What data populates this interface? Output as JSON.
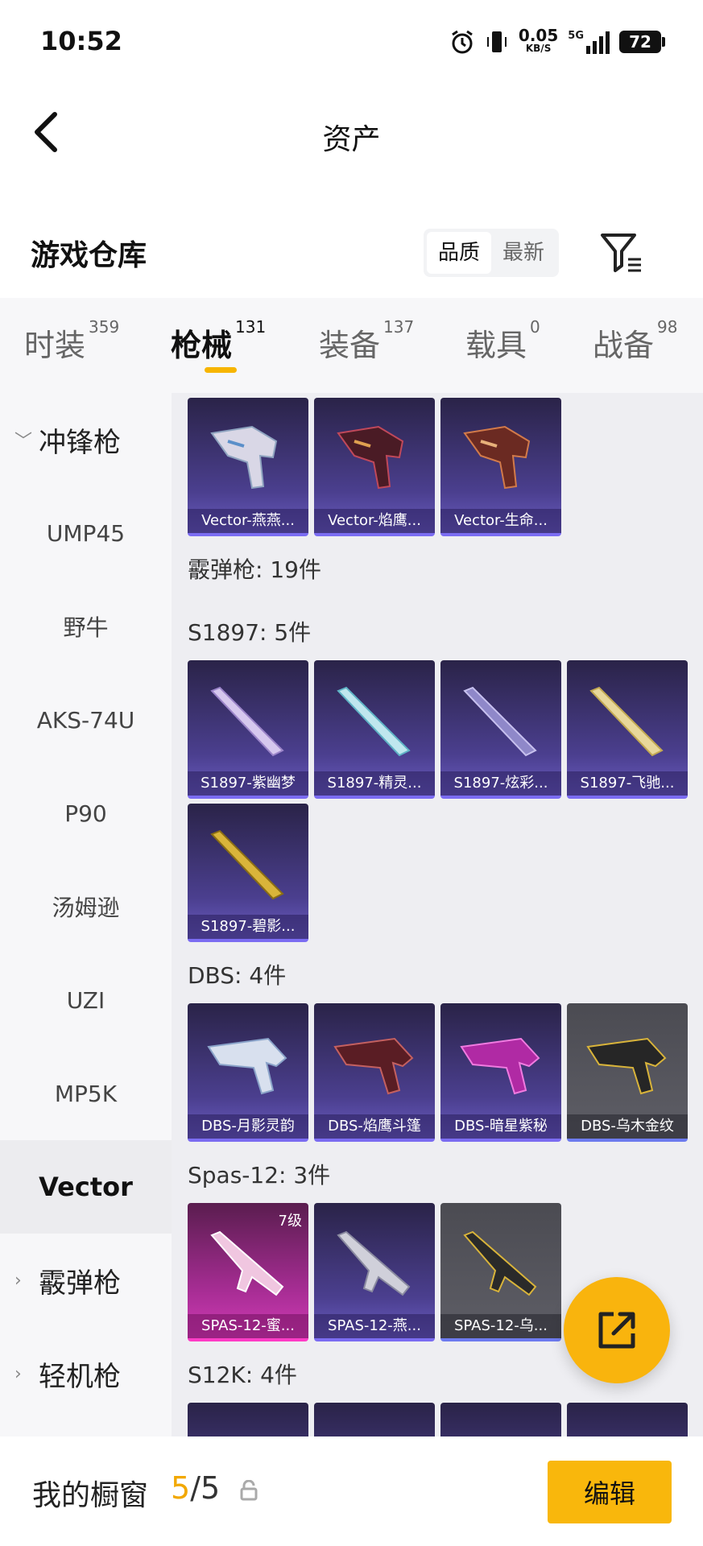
{
  "status": {
    "time": "10:52",
    "net_speed": "0.05",
    "net_unit": "KB/S",
    "signal": "5G",
    "battery": "72"
  },
  "header": {
    "title": "资产"
  },
  "warehouse": {
    "title": "游戏仓库",
    "sort_options": [
      "品质",
      "最新"
    ],
    "active_sort": "品质"
  },
  "tabs": [
    {
      "label": "时装",
      "count": "359"
    },
    {
      "label": "枪械",
      "count": "131"
    },
    {
      "label": "装备",
      "count": "137"
    },
    {
      "label": "载具",
      "count": "0"
    },
    {
      "label": "战备",
      "count": "98"
    }
  ],
  "active_tab": "枪械",
  "sidebar": {
    "group_smg": "冲锋枪",
    "items": [
      "UMP45",
      "野牛",
      "AKS-74U",
      "P90",
      "汤姆逊",
      "UZI",
      "MP5K",
      "Vector"
    ],
    "selected": "Vector",
    "group_shotgun": "霰弹枪",
    "group_lmg": "轻机枪"
  },
  "content": {
    "vector_cards": [
      "Vector-燕燕...",
      "Vector-焰鹰...",
      "Vector-生命..."
    ],
    "shotgun_header": "霰弹枪: 19件",
    "s1897_header": "S1897: 5件",
    "s1897_cards": [
      "S1897-紫幽梦",
      "S1897-精灵...",
      "S1897-炫彩...",
      "S1897-飞驰...",
      "S1897-碧影..."
    ],
    "dbs_header": "DBS: 4件",
    "dbs_cards": [
      "DBS-月影灵韵",
      "DBS-焰鹰斗篷",
      "DBS-暗星紫秘",
      "DBS-乌木金纹"
    ],
    "spas_header": "Spas-12: 3件",
    "spas_cards": [
      "SPAS-12-蜜...",
      "SPAS-12-燕...",
      "SPAS-12-乌..."
    ],
    "spas_level": "7级",
    "s12k_header": "S12K: 4件"
  },
  "bottom": {
    "label": "我的橱窗",
    "current": "5",
    "slash_total": "/5",
    "edit": "编辑"
  },
  "colors": {
    "accent": "#f9b70c",
    "epic": "#4b3f8f",
    "legend": "#a72d94"
  }
}
